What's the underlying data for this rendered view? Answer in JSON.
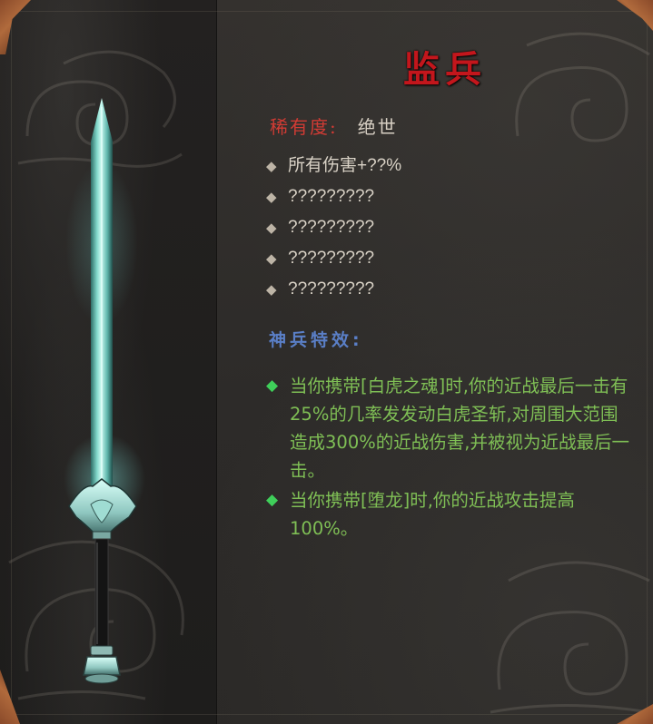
{
  "item": {
    "name": "监兵",
    "rarity_label": "稀有度:",
    "rarity_value": "绝世"
  },
  "stats": [
    "所有伤害+??%",
    "?????????",
    "?????????",
    "?????????",
    "?????????"
  ],
  "special": {
    "heading": "神兵特效:",
    "effects": [
      "当你携带[白虎之魂]时,你的近战最后一击有25%的几率发发动白虎圣斩,对周围大范围造成300%的近战伤害,并被视为近战最后一击。",
      "当你携带[堕龙]时,你的近战攻击提高100%。"
    ]
  },
  "icons": {
    "bullet": "diamond-icon",
    "effect_bullet": "green-diamond-icon",
    "weapon": "sword-icon"
  },
  "colors": {
    "title": "#c3161c",
    "rarity_label": "#d03b34",
    "effect_heading": "#5a7fc7",
    "effect_text": "#7fbf55",
    "effect_bullet": "#3fcf5a"
  }
}
